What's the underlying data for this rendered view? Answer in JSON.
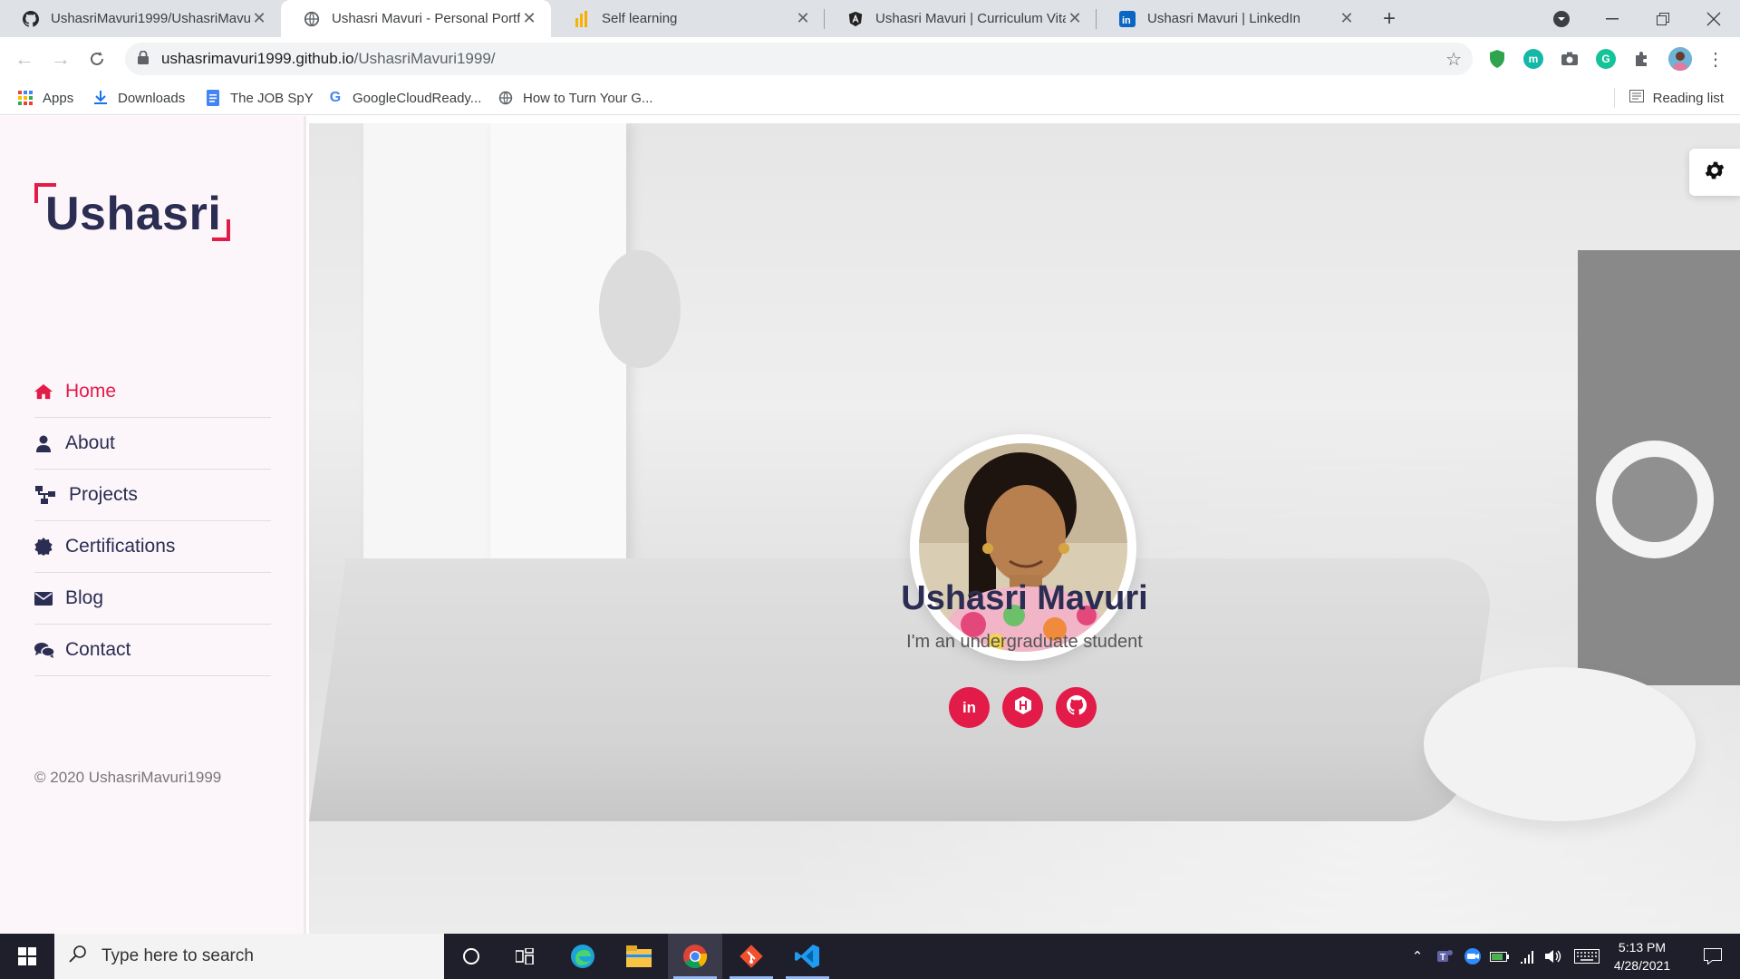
{
  "browser": {
    "tabs": [
      {
        "title": "UshasriMavuri1999/UshasriMavu",
        "icon": "github-icon"
      },
      {
        "title": "Ushasri Mavuri - Personal Portfol",
        "icon": "globe-icon"
      },
      {
        "title": "Self learning",
        "icon": "chart-icon"
      },
      {
        "title": "Ushasri Mavuri | Curriculum Vitae",
        "icon": "angular-icon"
      },
      {
        "title": "Ushasri Mavuri | LinkedIn",
        "icon": "linkedin-icon"
      }
    ],
    "active_tab": 1,
    "url_host": "ushasrimavuri1999.github.io",
    "url_path": "/UshasriMavuri1999/",
    "bookmarks": [
      {
        "label": "Apps",
        "icon": "apps-grid-icon"
      },
      {
        "label": "Downloads",
        "icon": "download-icon"
      },
      {
        "label": "The JOB SpY",
        "icon": "document-icon"
      },
      {
        "label": "GoogleCloudReady...",
        "icon": "google-icon"
      },
      {
        "label": "How to Turn Your G...",
        "icon": "globe-icon"
      }
    ],
    "reading_list": "Reading list"
  },
  "site": {
    "logo": "Ushasri",
    "menu": [
      {
        "label": "Home",
        "icon": "home-icon",
        "active": true
      },
      {
        "label": "About",
        "icon": "user-icon",
        "active": false
      },
      {
        "label": "Projects",
        "icon": "sitemap-icon",
        "active": false
      },
      {
        "label": "Certifications",
        "icon": "badge-icon",
        "active": false
      },
      {
        "label": "Blog",
        "icon": "envelope-icon",
        "active": false
      },
      {
        "label": "Contact",
        "icon": "comments-icon",
        "active": false
      }
    ],
    "copyright": "© 2020 UshasriMavuri1999",
    "hero": {
      "name": "Ushasri Mavuri",
      "tagline": "I'm an undergraduate student",
      "socials": [
        {
          "name": "linkedin",
          "glyph": "in"
        },
        {
          "name": "hackerrank",
          "glyph": "H"
        },
        {
          "name": "github",
          "glyph": "⬤"
        }
      ]
    }
  },
  "taskbar": {
    "search_placeholder": "Type here to search",
    "time": "5:13 PM",
    "date": "4/28/2021"
  },
  "colors": {
    "accent": "#e31b48",
    "navy": "#2b2d52"
  }
}
